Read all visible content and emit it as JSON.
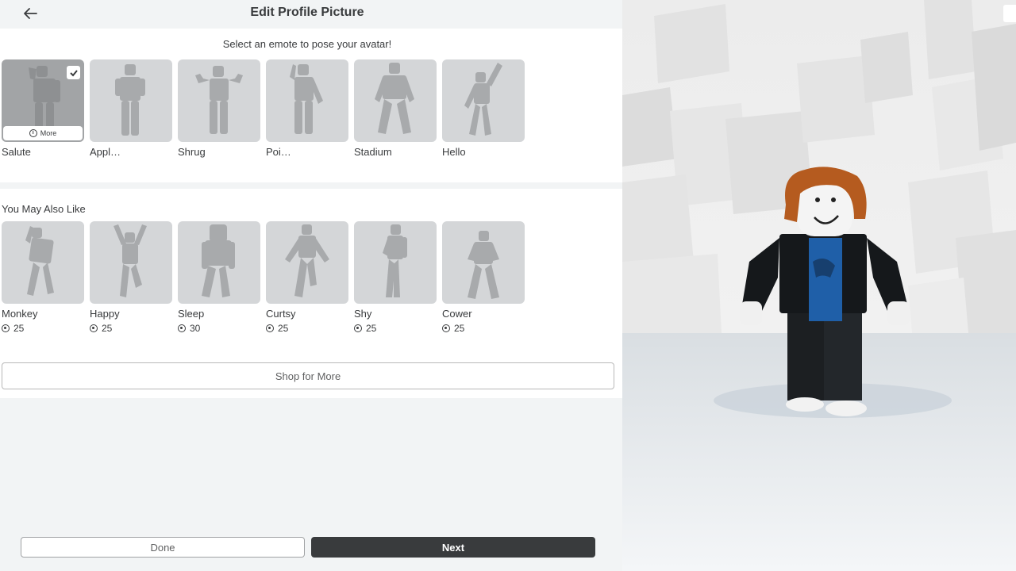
{
  "header": {
    "title": "Edit Profile Picture",
    "back_icon": "arrow-left-icon"
  },
  "emotes": {
    "subtitle": "Select an emote to pose your avatar!",
    "more_label": "More",
    "items": [
      {
        "name": "Salute",
        "selected": true
      },
      {
        "name": "Appl…",
        "selected": false
      },
      {
        "name": "Shrug",
        "selected": false
      },
      {
        "name": "Poi…",
        "selected": false
      },
      {
        "name": "Stadium",
        "selected": false
      },
      {
        "name": "Hello",
        "selected": false
      }
    ]
  },
  "recommended": {
    "title": "You May Also Like",
    "currency_icon": "robux-icon",
    "items": [
      {
        "name": "Monkey",
        "price": "25"
      },
      {
        "name": "Happy",
        "price": "25"
      },
      {
        "name": "Sleep",
        "price": "30"
      },
      {
        "name": "Curtsy",
        "price": "25"
      },
      {
        "name": "Shy",
        "price": "25"
      },
      {
        "name": "Cower",
        "price": "25"
      }
    ],
    "shop_label": "Shop for More"
  },
  "footer": {
    "done_label": "Done",
    "next_label": "Next"
  },
  "colors": {
    "primary_button": "#393b3d",
    "page_bg": "#f2f4f5",
    "tile_bg": "#d4d6d8",
    "tile_selected_bg": "#a2a4a6"
  }
}
